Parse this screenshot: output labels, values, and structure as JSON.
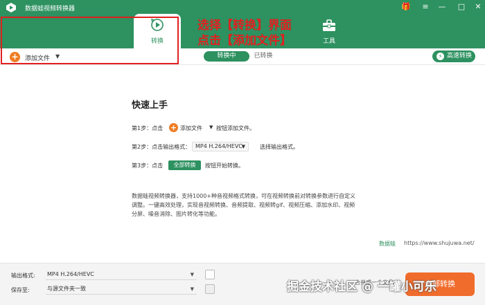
{
  "app": {
    "title": "数据蛙视频转换器"
  },
  "window_controls": {
    "gift": "🎁",
    "menu": "≡",
    "minimize": "—",
    "maximize": "□",
    "close": "✕"
  },
  "tabs": {
    "convert_label": "转换",
    "tools_label": "工具"
  },
  "annotation": {
    "line1": "选择【转换】界面",
    "line2": "点击【添加文件】"
  },
  "toolbar": {
    "add_file_label": "添加文件",
    "segments": {
      "converting": "转换中",
      "converted": "已转换"
    },
    "fast_convert_label": "高速转换"
  },
  "quick_start": {
    "title": "快速上手",
    "step1": {
      "prefix": "第1步：点击",
      "button": "添加文件",
      "suffix": "按钮添加文件。"
    },
    "step2": {
      "prefix": "第2步：点击输出格式：",
      "chip": "MP4 H.264/HEVC",
      "suffix": "选择输出格式。"
    },
    "step3": {
      "prefix": "第3步：点击",
      "button": "全部转换",
      "suffix": "按钮开始转换。"
    },
    "description": "数据蛙视频转换器，支持1000+种音视频格式转换，可在视频转换前对转换参数进行自定义调整。一键高效处理，实现音视频转换、音频提取、视频转gif、视频压缩、添加水印、视频分屏、噪音消除、图片转化等功能。"
  },
  "watermark": {
    "logo_text": "数据蛙",
    "url": "https://www.shujuwa.net/"
  },
  "bottom": {
    "output_format_label": "输出格式:",
    "output_format_value": "MP4 H.264/HEVC",
    "save_to_label": "保存至:",
    "save_to_value": "与源文件夹一致",
    "merge_label": "合并成一个文件",
    "convert_all_label": "全部转换"
  },
  "overlay_watermark": "掘金技术社区 @ 一罐小可乐",
  "colors": {
    "brand_green": "#2d9160",
    "accent_orange": "#f07c22",
    "annotation_red": "#e0201f"
  }
}
